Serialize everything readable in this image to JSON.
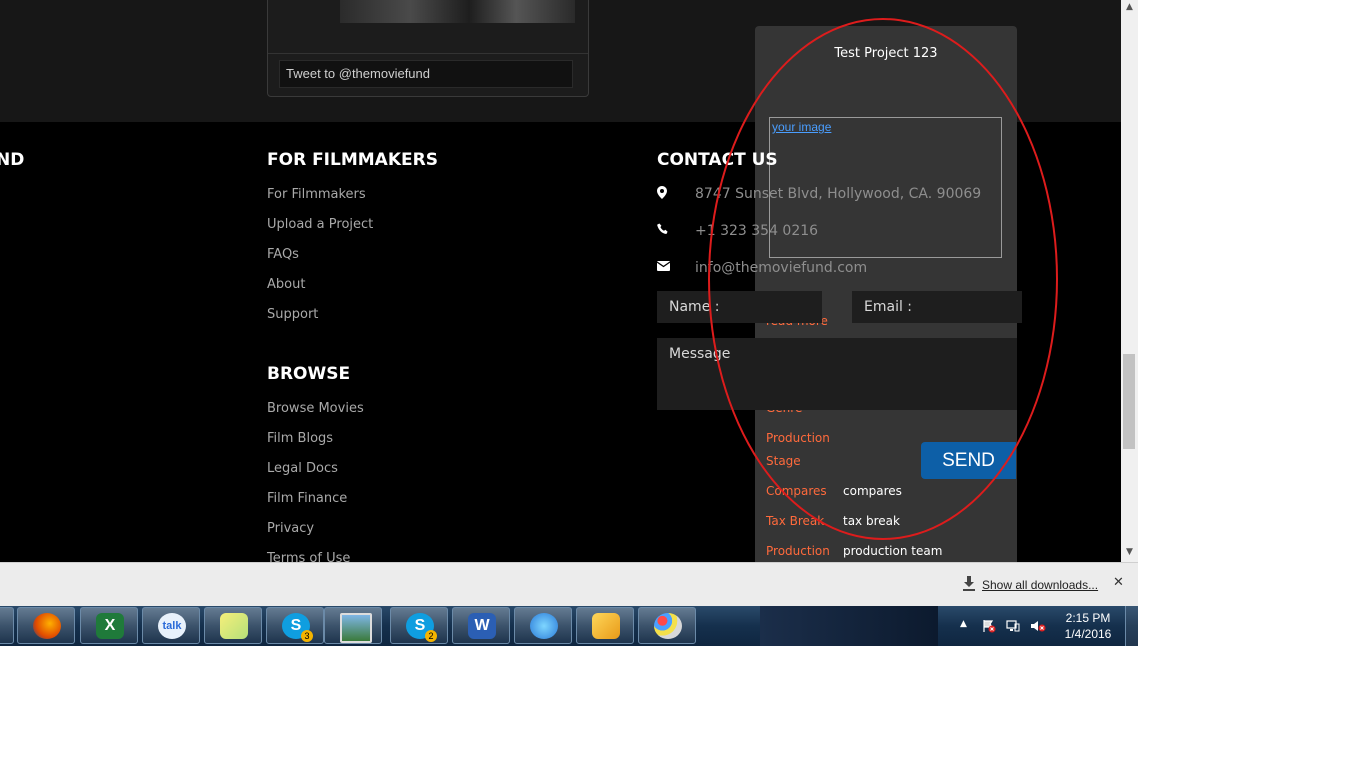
{
  "tweet": {
    "placeholder": "Tweet to @themoviefund"
  },
  "footer": {
    "partial_heading": "ND",
    "filmmakers": {
      "heading": "FOR FILMMAKERS",
      "links": [
        "For Filmmakers",
        "Upload a Project",
        "FAQs",
        "About",
        "Support"
      ]
    },
    "browse": {
      "heading": "BROWSE",
      "links": [
        "Browse Movies",
        "Film Blogs",
        "Legal Docs",
        "Film Finance",
        "Privacy",
        "Terms of Use"
      ]
    },
    "contact": {
      "heading": "CONTACT US",
      "address": "8747 Sunset Blvd, Hollywood, CA. 90069",
      "phone": "+1 323 354 0216",
      "email": "info@themoviefund.com",
      "name_placeholder": "Name :",
      "email_placeholder": "Email :",
      "message_placeholder": "Message",
      "send_label": "SEND"
    }
  },
  "project_panel": {
    "title": "Test Project 123",
    "image_alt": "your image",
    "read_more": "read more",
    "genre_label": "Genre",
    "production_stage_label": [
      "Production",
      "Stage"
    ],
    "compares_label": "Compares",
    "compares_value": "compares",
    "tax_break_label": "Tax Break",
    "tax_break_value": "tax break",
    "production_team_label": "Production",
    "production_team_value": "production team"
  },
  "downloads": {
    "show_all": "Show all downloads..."
  },
  "taskbar": {
    "apps": [
      "explorer",
      "firefox",
      "excel",
      "google-talk",
      "sticky-notes",
      "skype",
      "photo-viewer",
      "skype",
      "word",
      "messenger",
      "outlook",
      "paint"
    ],
    "skype_badges": [
      "3",
      "2"
    ],
    "time": "2:15 PM",
    "date": "1/4/2016"
  },
  "colors": {
    "accent_orange": "#ff6a3c",
    "send_blue": "#0d5fa7",
    "annotation_red": "#dd1c1c"
  }
}
